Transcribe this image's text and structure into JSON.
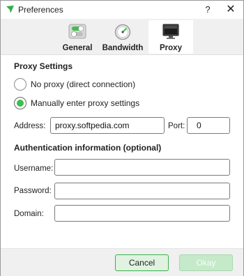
{
  "window": {
    "title": "Preferences",
    "help_label": "?",
    "close_label": "✕"
  },
  "tabs": [
    {
      "label": "General",
      "icon": "toggle-switch-icon"
    },
    {
      "label": "Bandwidth",
      "icon": "speedometer-gauge-icon"
    },
    {
      "label": "Proxy",
      "icon": "monitor-icon",
      "selected": true
    }
  ],
  "proxy_settings": {
    "title": "Proxy Settings",
    "no_proxy_label": "No proxy (direct connection)",
    "manual_label": "Manually enter proxy settings",
    "selected": "manual",
    "address_label": "Address:",
    "address_value": "proxy.softpedia.com",
    "port_label": "Port:",
    "port_value": "0"
  },
  "auth": {
    "title": "Authentication information (optional)",
    "username_label": "Username:",
    "username_value": "",
    "password_label": "Password:",
    "password_value": "",
    "domain_label": "Domain:",
    "domain_value": ""
  },
  "footer": {
    "cancel_label": "Cancel",
    "okay_label": "Okay"
  },
  "colors": {
    "accent_green": "#3cbf4e",
    "okay_disabled_bg": "#c5e9c9",
    "cancel_bg": "#dff3e0"
  }
}
